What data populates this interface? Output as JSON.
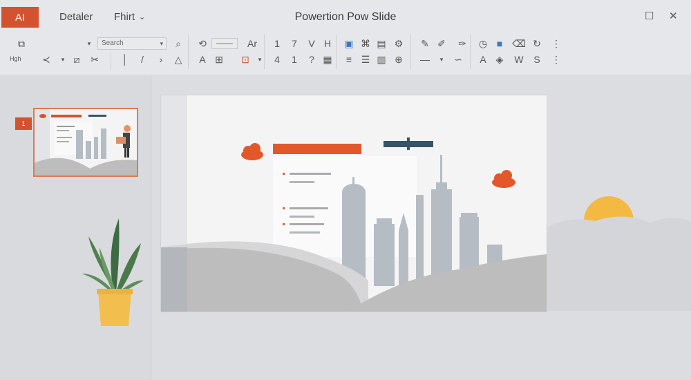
{
  "app": {
    "badge": "AI",
    "title": "Powertion Pow Slide"
  },
  "menu": {
    "item1": "Detaler",
    "item2": "Fhirt"
  },
  "window": {
    "restore_icon": "restore-icon",
    "close_icon": "close-icon"
  },
  "ribbon": {
    "search_placeholder": "Search",
    "font_label": "Ar",
    "small_label": "Hgh",
    "row1_glyphs": [
      "1",
      "7",
      "V",
      "H"
    ],
    "row2_glyphs": [
      "4",
      "1",
      "?"
    ],
    "extra_glyphs": [
      "W",
      "S",
      "A"
    ]
  },
  "thumbnail": {
    "slide_number": "1"
  },
  "colors": {
    "accent": "#d35230",
    "slide_bg": "#f4f4f5",
    "building": "#b5bcc4",
    "hill": "#bdbdbd",
    "plant_pot": "#f2bf4f",
    "sun": "#f4b942"
  }
}
